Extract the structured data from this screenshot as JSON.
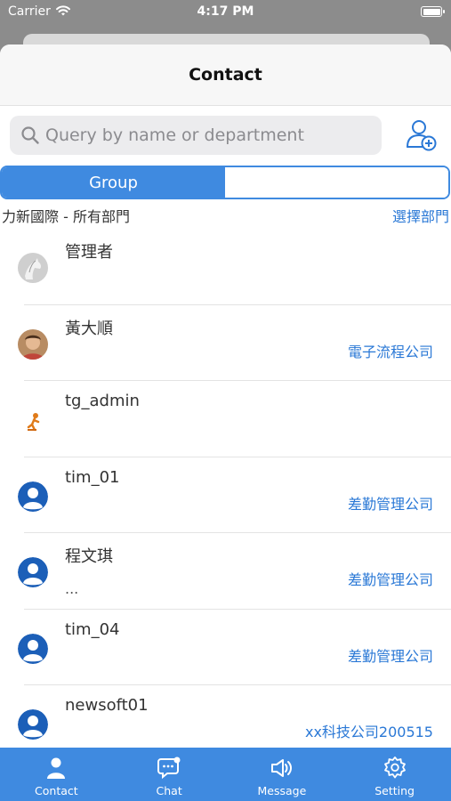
{
  "status_bar": {
    "carrier": "Carrier",
    "time": "4:17 PM"
  },
  "header": {
    "title": "Contact"
  },
  "search": {
    "placeholder": "Query by name or department",
    "value": ""
  },
  "segments": {
    "active": "Group",
    "inactive": ""
  },
  "org": {
    "name": "力新國際 - 所有部門",
    "select_label": "選擇部門"
  },
  "contacts": [
    {
      "name": "管理者",
      "dept": "",
      "extra": "",
      "avatar": "photo-horse"
    },
    {
      "name": "黃大順",
      "dept": "電子流程公司",
      "extra": "",
      "avatar": "photo-person"
    },
    {
      "name": "tg_admin",
      "dept": "",
      "extra": "",
      "avatar": "figure-orange"
    },
    {
      "name": "tim_01",
      "dept": "差勤管理公司",
      "extra": "",
      "avatar": "default-user-icon"
    },
    {
      "name": "程文琪",
      "dept": "差勤管理公司",
      "extra": "...",
      "avatar": "default-user-icon"
    },
    {
      "name": "tim_04",
      "dept": "差勤管理公司",
      "extra": "",
      "avatar": "default-user-icon"
    },
    {
      "name": "newsoft01",
      "dept": "xx科技公司200515",
      "extra": "",
      "avatar": "default-user-icon"
    }
  ],
  "tabs": [
    {
      "label": "Contact",
      "icon": "contact-icon"
    },
    {
      "label": "Chat",
      "icon": "chat-icon"
    },
    {
      "label": "Message",
      "icon": "megaphone-icon"
    },
    {
      "label": "Setting",
      "icon": "gear-icon"
    }
  ],
  "colors": {
    "accent": "#3f8ae0",
    "link": "#2a78d6",
    "avatar_default": "#1c5fb8"
  }
}
